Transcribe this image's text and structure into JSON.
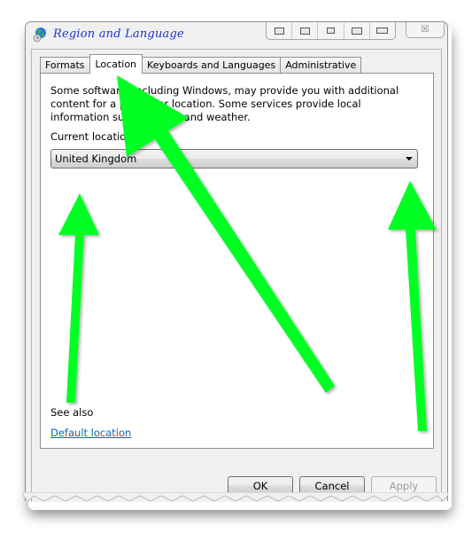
{
  "window": {
    "title": "Region and Language",
    "title_icon": "globe-clock-icon",
    "titlebar_buttons": [
      "snap-left-icon",
      "restore-icon",
      "center-icon",
      "snap-right-icon",
      "maximize-width-icon"
    ],
    "close_icon": "close-icon",
    "close_glyph": "☒"
  },
  "tabs": [
    {
      "label": "Formats",
      "active": false
    },
    {
      "label": "Location",
      "active": true
    },
    {
      "label": "Keyboards and Languages",
      "active": false
    },
    {
      "label": "Administrative",
      "active": false
    }
  ],
  "location_tab": {
    "description": "Some software, including Windows, may provide you with additional content for a particular location. Some services provide local information such as news and weather.",
    "current_location_label": "Current location:",
    "current_location_value": "United Kingdom",
    "see_also_label": "See also",
    "default_location_link": "Default location"
  },
  "buttons": {
    "ok": "OK",
    "cancel": "Cancel",
    "apply": "Apply",
    "apply_enabled": false
  },
  "annotations": {
    "arrow_color": "#00ff22",
    "arrows": [
      "arrow-to-location-tab",
      "arrow-to-dropdown-left",
      "arrow-to-dropdown-right"
    ]
  },
  "colors": {
    "title_text": "#1d33c8",
    "link": "#0066cc",
    "window_bg": "#f0f0f0"
  }
}
